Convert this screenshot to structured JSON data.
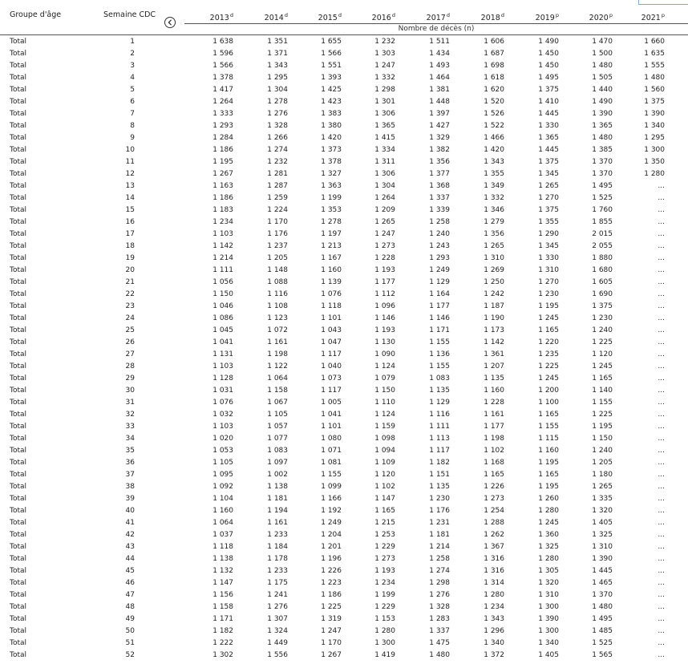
{
  "header": {
    "age_group": "Groupe d'âge",
    "week": "Semaine CDC",
    "subheader": "Nombre de décès (n)",
    "years": [
      {
        "label": "2013",
        "note": "d"
      },
      {
        "label": "2014",
        "note": "d"
      },
      {
        "label": "2015",
        "note": "d"
      },
      {
        "label": "2016",
        "note": "d"
      },
      {
        "label": "2017",
        "note": "d"
      },
      {
        "label": "2018",
        "note": "d"
      },
      {
        "label": "2019",
        "note": "p"
      },
      {
        "label": "2020",
        "note": "p"
      },
      {
        "label": "2021",
        "note": "p"
      }
    ]
  },
  "nav": {
    "icon": "chevron-left-icon"
  },
  "rows": [
    {
      "group": "Total",
      "week": "1",
      "values": [
        "1 638",
        "1 351",
        "1 655",
        "1 232",
        "1 511",
        "1 606",
        "1 490",
        "1 470",
        "1 660"
      ]
    },
    {
      "group": "Total",
      "week": "2",
      "values": [
        "1 596",
        "1 371",
        "1 566",
        "1 303",
        "1 434",
        "1 687",
        "1 450",
        "1 500",
        "1 635"
      ]
    },
    {
      "group": "Total",
      "week": "3",
      "values": [
        "1 566",
        "1 343",
        "1 551",
        "1 247",
        "1 493",
        "1 698",
        "1 450",
        "1 480",
        "1 555"
      ]
    },
    {
      "group": "Total",
      "week": "4",
      "values": [
        "1 378",
        "1 295",
        "1 393",
        "1 332",
        "1 464",
        "1 618",
        "1 495",
        "1 505",
        "1 480"
      ]
    },
    {
      "group": "Total",
      "week": "5",
      "values": [
        "1 417",
        "1 304",
        "1 425",
        "1 298",
        "1 381",
        "1 620",
        "1 375",
        "1 440",
        "1 560"
      ]
    },
    {
      "group": "Total",
      "week": "6",
      "values": [
        "1 264",
        "1 278",
        "1 423",
        "1 301",
        "1 448",
        "1 520",
        "1 410",
        "1 490",
        "1 375"
      ]
    },
    {
      "group": "Total",
      "week": "7",
      "values": [
        "1 333",
        "1 276",
        "1 383",
        "1 306",
        "1 397",
        "1 526",
        "1 445",
        "1 390",
        "1 390"
      ]
    },
    {
      "group": "Total",
      "week": "8",
      "values": [
        "1 293",
        "1 328",
        "1 380",
        "1 365",
        "1 427",
        "1 522",
        "1 330",
        "1 365",
        "1 340"
      ]
    },
    {
      "group": "Total",
      "week": "9",
      "values": [
        "1 284",
        "1 266",
        "1 420",
        "1 415",
        "1 329",
        "1 466",
        "1 365",
        "1 480",
        "1 295"
      ]
    },
    {
      "group": "Total",
      "week": "10",
      "values": [
        "1 186",
        "1 274",
        "1 373",
        "1 334",
        "1 382",
        "1 420",
        "1 445",
        "1 385",
        "1 300"
      ]
    },
    {
      "group": "Total",
      "week": "11",
      "values": [
        "1 195",
        "1 232",
        "1 378",
        "1 311",
        "1 356",
        "1 343",
        "1 375",
        "1 370",
        "1 350"
      ]
    },
    {
      "group": "Total",
      "week": "12",
      "values": [
        "1 267",
        "1 281",
        "1 327",
        "1 306",
        "1 377",
        "1 355",
        "1 345",
        "1 370",
        "1 280"
      ]
    },
    {
      "group": "Total",
      "week": "13",
      "values": [
        "1 163",
        "1 287",
        "1 363",
        "1 304",
        "1 368",
        "1 349",
        "1 265",
        "1 495",
        "..."
      ]
    },
    {
      "group": "Total",
      "week": "14",
      "values": [
        "1 186",
        "1 259",
        "1 199",
        "1 264",
        "1 337",
        "1 332",
        "1 270",
        "1 525",
        "..."
      ]
    },
    {
      "group": "Total",
      "week": "15",
      "values": [
        "1 183",
        "1 224",
        "1 353",
        "1 209",
        "1 339",
        "1 346",
        "1 375",
        "1 760",
        "..."
      ]
    },
    {
      "group": "Total",
      "week": "16",
      "values": [
        "1 234",
        "1 170",
        "1 278",
        "1 265",
        "1 258",
        "1 279",
        "1 355",
        "1 855",
        "..."
      ]
    },
    {
      "group": "Total",
      "week": "17",
      "values": [
        "1 103",
        "1 176",
        "1 197",
        "1 247",
        "1 240",
        "1 356",
        "1 290",
        "2 015",
        "..."
      ]
    },
    {
      "group": "Total",
      "week": "18",
      "values": [
        "1 142",
        "1 237",
        "1 213",
        "1 273",
        "1 243",
        "1 265",
        "1 345",
        "2 055",
        "..."
      ]
    },
    {
      "group": "Total",
      "week": "19",
      "values": [
        "1 214",
        "1 205",
        "1 167",
        "1 228",
        "1 293",
        "1 310",
        "1 330",
        "1 880",
        "..."
      ]
    },
    {
      "group": "Total",
      "week": "20",
      "values": [
        "1 111",
        "1 148",
        "1 160",
        "1 193",
        "1 249",
        "1 269",
        "1 310",
        "1 680",
        "..."
      ]
    },
    {
      "group": "Total",
      "week": "21",
      "values": [
        "1 056",
        "1 088",
        "1 139",
        "1 177",
        "1 129",
        "1 250",
        "1 270",
        "1 605",
        "..."
      ]
    },
    {
      "group": "Total",
      "week": "22",
      "values": [
        "1 150",
        "1 116",
        "1 076",
        "1 112",
        "1 164",
        "1 242",
        "1 230",
        "1 690",
        "..."
      ]
    },
    {
      "group": "Total",
      "week": "23",
      "values": [
        "1 046",
        "1 108",
        "1 118",
        "1 096",
        "1 177",
        "1 187",
        "1 195",
        "1 375",
        "..."
      ]
    },
    {
      "group": "Total",
      "week": "24",
      "values": [
        "1 086",
        "1 123",
        "1 101",
        "1 146",
        "1 146",
        "1 190",
        "1 245",
        "1 230",
        "..."
      ]
    },
    {
      "group": "Total",
      "week": "25",
      "values": [
        "1 045",
        "1 072",
        "1 043",
        "1 193",
        "1 171",
        "1 173",
        "1 165",
        "1 240",
        "..."
      ]
    },
    {
      "group": "Total",
      "week": "26",
      "values": [
        "1 041",
        "1 161",
        "1 047",
        "1 130",
        "1 155",
        "1 142",
        "1 220",
        "1 225",
        "..."
      ]
    },
    {
      "group": "Total",
      "week": "27",
      "values": [
        "1 131",
        "1 198",
        "1 117",
        "1 090",
        "1 136",
        "1 361",
        "1 235",
        "1 120",
        "..."
      ]
    },
    {
      "group": "Total",
      "week": "28",
      "values": [
        "1 103",
        "1 122",
        "1 040",
        "1 124",
        "1 155",
        "1 207",
        "1 225",
        "1 245",
        "..."
      ]
    },
    {
      "group": "Total",
      "week": "29",
      "values": [
        "1 128",
        "1 064",
        "1 073",
        "1 079",
        "1 083",
        "1 135",
        "1 245",
        "1 165",
        "..."
      ]
    },
    {
      "group": "Total",
      "week": "30",
      "values": [
        "1 031",
        "1 158",
        "1 117",
        "1 150",
        "1 135",
        "1 160",
        "1 200",
        "1 140",
        "..."
      ]
    },
    {
      "group": "Total",
      "week": "31",
      "values": [
        "1 076",
        "1 067",
        "1 005",
        "1 110",
        "1 129",
        "1 228",
        "1 100",
        "1 155",
        "..."
      ]
    },
    {
      "group": "Total",
      "week": "32",
      "values": [
        "1 032",
        "1 105",
        "1 041",
        "1 124",
        "1 116",
        "1 161",
        "1 165",
        "1 225",
        "..."
      ]
    },
    {
      "group": "Total",
      "week": "33",
      "values": [
        "1 103",
        "1 057",
        "1 101",
        "1 159",
        "1 111",
        "1 177",
        "1 155",
        "1 195",
        "..."
      ]
    },
    {
      "group": "Total",
      "week": "34",
      "values": [
        "1 020",
        "1 077",
        "1 080",
        "1 098",
        "1 113",
        "1 198",
        "1 115",
        "1 150",
        "..."
      ]
    },
    {
      "group": "Total",
      "week": "35",
      "values": [
        "1 053",
        "1 083",
        "1 071",
        "1 094",
        "1 117",
        "1 102",
        "1 160",
        "1 240",
        "..."
      ]
    },
    {
      "group": "Total",
      "week": "36",
      "values": [
        "1 105",
        "1 097",
        "1 081",
        "1 109",
        "1 182",
        "1 168",
        "1 195",
        "1 205",
        "..."
      ]
    },
    {
      "group": "Total",
      "week": "37",
      "values": [
        "1 095",
        "1 002",
        "1 155",
        "1 120",
        "1 151",
        "1 165",
        "1 165",
        "1 180",
        "..."
      ]
    },
    {
      "group": "Total",
      "week": "38",
      "values": [
        "1 092",
        "1 138",
        "1 099",
        "1 102",
        "1 135",
        "1 226",
        "1 195",
        "1 265",
        "..."
      ]
    },
    {
      "group": "Total",
      "week": "39",
      "values": [
        "1 104",
        "1 181",
        "1 166",
        "1 147",
        "1 230",
        "1 273",
        "1 260",
        "1 335",
        "..."
      ]
    },
    {
      "group": "Total",
      "week": "40",
      "values": [
        "1 160",
        "1 194",
        "1 192",
        "1 165",
        "1 176",
        "1 254",
        "1 280",
        "1 320",
        "..."
      ]
    },
    {
      "group": "Total",
      "week": "41",
      "values": [
        "1 064",
        "1 161",
        "1 249",
        "1 215",
        "1 231",
        "1 288",
        "1 245",
        "1 405",
        "..."
      ]
    },
    {
      "group": "Total",
      "week": "42",
      "values": [
        "1 037",
        "1 233",
        "1 204",
        "1 253",
        "1 181",
        "1 262",
        "1 360",
        "1 325",
        "..."
      ]
    },
    {
      "group": "Total",
      "week": "43",
      "values": [
        "1 118",
        "1 184",
        "1 201",
        "1 229",
        "1 214",
        "1 367",
        "1 325",
        "1 310",
        "..."
      ]
    },
    {
      "group": "Total",
      "week": "44",
      "values": [
        "1 138",
        "1 178",
        "1 196",
        "1 273",
        "1 258",
        "1 316",
        "1 280",
        "1 390",
        "..."
      ]
    },
    {
      "group": "Total",
      "week": "45",
      "values": [
        "1 132",
        "1 233",
        "1 226",
        "1 193",
        "1 274",
        "1 316",
        "1 305",
        "1 445",
        "..."
      ]
    },
    {
      "group": "Total",
      "week": "46",
      "values": [
        "1 147",
        "1 175",
        "1 223",
        "1 234",
        "1 298",
        "1 314",
        "1 320",
        "1 465",
        "..."
      ]
    },
    {
      "group": "Total",
      "week": "47",
      "values": [
        "1 156",
        "1 241",
        "1 186",
        "1 199",
        "1 276",
        "1 280",
        "1 310",
        "1 370",
        "..."
      ]
    },
    {
      "group": "Total",
      "week": "48",
      "values": [
        "1 158",
        "1 276",
        "1 225",
        "1 229",
        "1 328",
        "1 234",
        "1 300",
        "1 480",
        "..."
      ]
    },
    {
      "group": "Total",
      "week": "49",
      "values": [
        "1 171",
        "1 307",
        "1 319",
        "1 153",
        "1 283",
        "1 343",
        "1 390",
        "1 495",
        "..."
      ]
    },
    {
      "group": "Total",
      "week": "50",
      "values": [
        "1 182",
        "1 324",
        "1 247",
        "1 280",
        "1 337",
        "1 296",
        "1 300",
        "1 485",
        "..."
      ]
    },
    {
      "group": "Total",
      "week": "51",
      "values": [
        "1 222",
        "1 449",
        "1 170",
        "1 300",
        "1 475",
        "1 340",
        "1 340",
        "1 525",
        "..."
      ]
    },
    {
      "group": "Total",
      "week": "52",
      "values": [
        "1 302",
        "1 556",
        "1 267",
        "1 419",
        "1 480",
        "1 372",
        "1 405",
        "1 565",
        "..."
      ]
    }
  ]
}
